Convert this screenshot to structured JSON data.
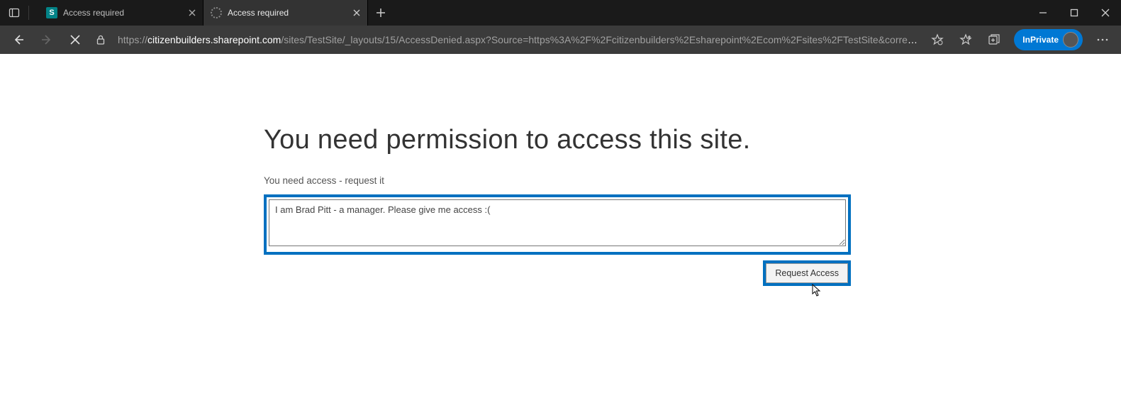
{
  "titlebar": {
    "tabs": [
      {
        "title": "Access required",
        "favicon_letter": "S"
      },
      {
        "title": "Access required"
      }
    ]
  },
  "addressbar": {
    "url_host": "https://",
    "url_domain": "citizenbuilders.sharepoint.com",
    "url_path": "/sites/TestSite/_layouts/15/AccessDenied.aspx?Source=https%3A%2F%2Fcitizenbuilders%2Esharepoint%2Ecom%2Fsites%2FTestSite&correl...",
    "inprivate_label": "InPrivate"
  },
  "page": {
    "heading": "You need permission to access this site.",
    "subtext": "You need access - request it",
    "request_message": "I am Brad Pitt - a manager. Please give me access :(",
    "button_label": "Request Access"
  }
}
